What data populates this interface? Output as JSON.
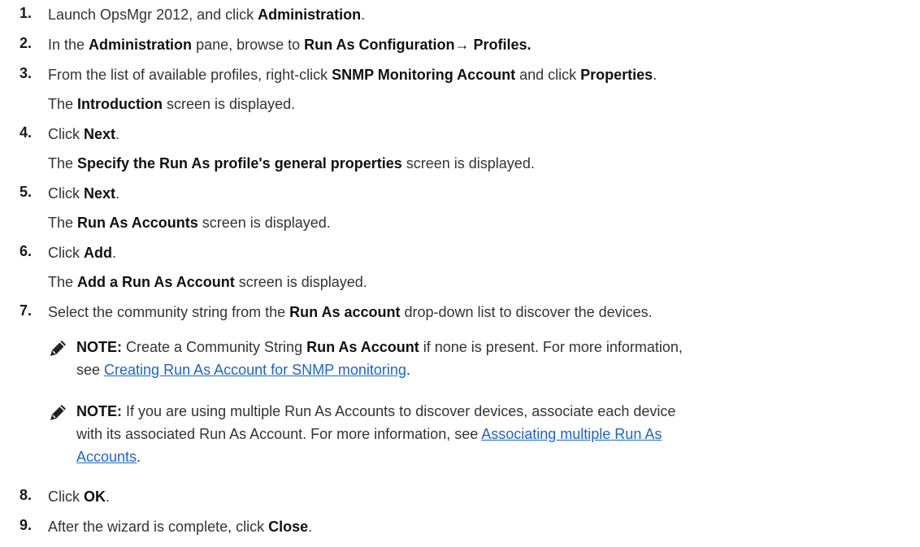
{
  "steps": [
    {
      "num": "1.",
      "parts": [
        "Launch OpsMgr 2012, and click ",
        "Administration",
        "."
      ]
    },
    {
      "num": "2.",
      "parts": [
        "In the ",
        "Administration",
        " pane, browse to ",
        "Run As Configuration→ Profiles.",
        ""
      ]
    },
    {
      "num": "3.",
      "parts": [
        "From the list of available profiles, right-click ",
        "SNMP Monitoring Account",
        " and click ",
        "Properties",
        "."
      ],
      "sub": [
        "The ",
        "Introduction",
        " screen is displayed."
      ]
    },
    {
      "num": "4.",
      "parts": [
        "Click ",
        "Next",
        "."
      ],
      "sub": [
        "The ",
        "Specify the Run As profile's general properties",
        " screen is displayed."
      ]
    },
    {
      "num": "5.",
      "parts": [
        "Click ",
        "Next",
        "."
      ],
      "sub": [
        "The ",
        "Run As Accounts",
        " screen is displayed."
      ]
    },
    {
      "num": "6.",
      "parts": [
        "Click ",
        "Add",
        "."
      ],
      "sub": [
        "The ",
        "Add a Run As Account",
        " screen is displayed."
      ]
    },
    {
      "num": "7.",
      "parts": [
        "Select the community string from the ",
        "Run As account",
        " drop-down list to discover the devices."
      ]
    },
    {
      "num": "8.",
      "parts": [
        "Click ",
        "OK",
        "."
      ]
    },
    {
      "num": "9.",
      "parts": [
        "After the wizard is complete, click ",
        "Close",
        "."
      ]
    }
  ],
  "notes": [
    {
      "label": "NOTE:",
      "text1": " Create a Community String ",
      "bold1": "Run As Account",
      "text2": " if none is present. For more information,",
      "text3": "see ",
      "link": "Creating Run As Account for SNMP monitoring",
      "text4": "."
    },
    {
      "label": "NOTE:",
      "text1": " If you are using multiple Run As Accounts to discover devices, associate each device",
      "text2": "with its associated Run As Account. For more information, see ",
      "link1": "Associating multiple Run As",
      "link2": "Accounts",
      "text3": "."
    }
  ],
  "icons": {
    "note": "note-pencil-icon"
  },
  "colors": {
    "link": "#1a66c8",
    "text": "#333333"
  }
}
